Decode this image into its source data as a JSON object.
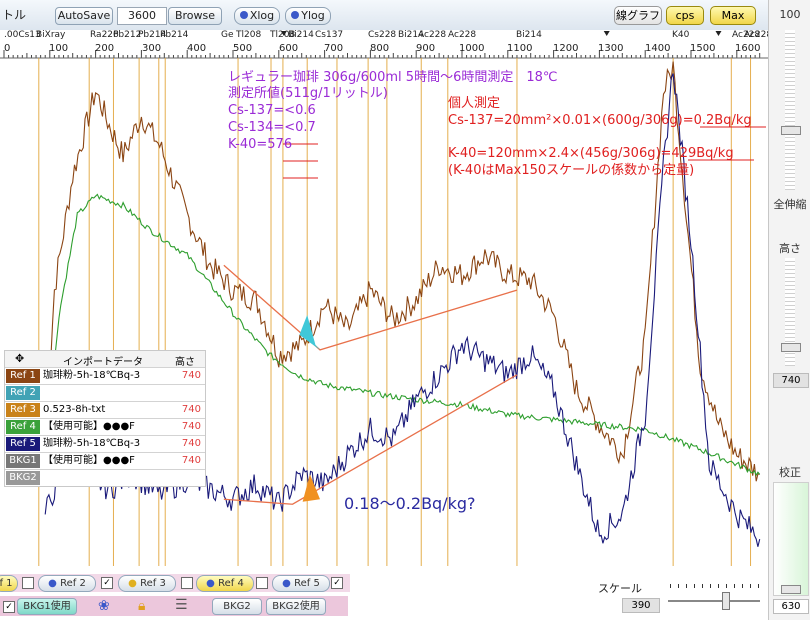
{
  "toolbar": {
    "title_fragment": "トル",
    "autosave": "AutoSave",
    "count_value": "3600",
    "browse": "Browse",
    "xlog": "Xlog",
    "ylog": "Ylog",
    "line_graph": "線グラフ",
    "cps": "cps",
    "max": "Max"
  },
  "ruler": {
    "energy_ticks": [
      "0",
      "100",
      "200",
      "300",
      "400",
      "500",
      "600",
      "700",
      "800",
      "900",
      "1000",
      "1100",
      "1200",
      "1300",
      "1400",
      "1500",
      "1600"
    ],
    "nuclide_labels": [
      ".00Cs13",
      "BiXray",
      "Ra226",
      "Pb212",
      "Pb214",
      "Pb214",
      "Ge",
      "Tl208",
      "Tl208",
      "Bi214",
      "Cs137",
      "Cs228",
      "Bi214",
      "Ac228",
      "Ac228",
      "Bi214",
      "K40",
      "Ac228",
      "Ac228"
    ]
  },
  "annotations": {
    "line1": "レギュラー珈琲 306g/600ml 5時間～6時間測定　18℃",
    "line2": "測定所値(511g/1リットル)",
    "line3": "Cs-137=<0.6",
    "line4": "Cs-134=<0.7",
    "line5": "K-40=576",
    "personal_title": "個人測定",
    "personal_cs": "Cs-137=20mm²×0.01×(600g/306g)=0.2Bq/kg",
    "personal_k": "K-40=120mm×2.4×(456g/306g)=429Bq/kg",
    "personal_note": "(K-40はMax150スケールの係数から定量)",
    "estimate": "0.18～0.2Bq/kg?"
  },
  "ref_panel": {
    "header_import": "インポートデータ",
    "header_height": "高さ",
    "rows": [
      {
        "tag": "Ref 1",
        "name": "珈琲粉-5h-18℃Bq-3",
        "value": "740",
        "color": "#8b4513"
      },
      {
        "tag": "Ref 2",
        "name": "",
        "value": "",
        "color": "#41a3b5"
      },
      {
        "tag": "Ref 3",
        "name": "0.523-8h-txt",
        "value": "740",
        "color": "#c9821a"
      },
      {
        "tag": "Ref 4",
        "name": "【使用可能】●●●F",
        "value": "740",
        "color": "#3aa13a"
      },
      {
        "tag": "Ref 5",
        "name": "珈琲粉-5h-18℃Bq-3",
        "value": "740",
        "color": "#1a1a7a"
      },
      {
        "tag": "BKG1",
        "name": "【使用可能】●●●F",
        "value": "740",
        "color": "#777777"
      },
      {
        "tag": "BKG2",
        "name": "",
        "value": "",
        "color": "#999999"
      }
    ]
  },
  "bottom": {
    "f1": "f 1",
    "ref2": "Ref 2",
    "ref3": "Ref 3",
    "ref4": "Ref 4",
    "ref5": "Ref 5",
    "bkg1_use": "BKG1使用",
    "bkg2": "BKG2",
    "bkg2_use": "BKG2使用",
    "scale_label": "スケール",
    "scale_value": "390"
  },
  "sidebar": {
    "top_value": "100",
    "full_width": "全伸縮",
    "height_label": "高さ",
    "height_value": "740",
    "calib_label": "校正",
    "bottom_value": "630"
  },
  "chart_data": {
    "type": "line",
    "xlabel": "",
    "ylabel": "",
    "xlim": [
      0,
      1650
    ],
    "peak_markers_keV": [
      76,
      186,
      239,
      295,
      338,
      352,
      511,
      583,
      609,
      662,
      727,
      795,
      836,
      911,
      969,
      1120,
      1461,
      1588,
      1630
    ],
    "series": [
      {
        "name": "Ref 1",
        "color": "#8b4513",
        "points": [
          [
            90,
            0.22
          ],
          [
            110,
            0.55
          ],
          [
            150,
            0.78
          ],
          [
            200,
            0.95
          ],
          [
            230,
            0.88
          ],
          [
            260,
            0.82
          ],
          [
            300,
            0.9
          ],
          [
            340,
            0.84
          ],
          [
            400,
            0.7
          ],
          [
            450,
            0.6
          ],
          [
            500,
            0.55
          ],
          [
            550,
            0.53
          ],
          [
            600,
            0.42
          ],
          [
            650,
            0.44
          ],
          [
            700,
            0.52
          ],
          [
            750,
            0.47
          ],
          [
            800,
            0.55
          ],
          [
            850,
            0.49
          ],
          [
            900,
            0.53
          ],
          [
            950,
            0.6
          ],
          [
            1000,
            0.58
          ],
          [
            1050,
            0.62
          ],
          [
            1100,
            0.58
          ],
          [
            1150,
            0.57
          ],
          [
            1200,
            0.5
          ],
          [
            1250,
            0.35
          ],
          [
            1300,
            0.28
          ],
          [
            1350,
            0.22
          ],
          [
            1400,
            0.45
          ],
          [
            1440,
            0.95
          ],
          [
            1461,
            1.0
          ],
          [
            1490,
            0.7
          ],
          [
            1520,
            0.4
          ],
          [
            1560,
            0.28
          ],
          [
            1600,
            0.22
          ],
          [
            1650,
            0.18
          ]
        ]
      },
      {
        "name": "Ref 4",
        "color": "#2e9e2e",
        "points": [
          [
            90,
            0.2
          ],
          [
            120,
            0.5
          ],
          [
            160,
            0.7
          ],
          [
            200,
            0.74
          ],
          [
            260,
            0.72
          ],
          [
            320,
            0.67
          ],
          [
            400,
            0.62
          ],
          [
            460,
            0.55
          ],
          [
            520,
            0.48
          ],
          [
            580,
            0.42
          ],
          [
            640,
            0.38
          ],
          [
            700,
            0.36
          ],
          [
            760,
            0.35
          ],
          [
            820,
            0.34
          ],
          [
            900,
            0.33
          ],
          [
            1000,
            0.32
          ],
          [
            1100,
            0.3
          ],
          [
            1200,
            0.29
          ],
          [
            1300,
            0.28
          ],
          [
            1400,
            0.27
          ],
          [
            1461,
            0.25
          ],
          [
            1520,
            0.23
          ],
          [
            1600,
            0.2
          ],
          [
            1650,
            0.18
          ]
        ]
      },
      {
        "name": "Ref 5",
        "color": "#1a1a7a",
        "points": [
          [
            90,
            0.1
          ],
          [
            130,
            0.2
          ],
          [
            180,
            0.18
          ],
          [
            230,
            0.15
          ],
          [
            280,
            0.18
          ],
          [
            340,
            0.14
          ],
          [
            400,
            0.17
          ],
          [
            450,
            0.15
          ],
          [
            500,
            0.13
          ],
          [
            550,
            0.16
          ],
          [
            600,
            0.12
          ],
          [
            650,
            0.18
          ],
          [
            700,
            0.16
          ],
          [
            750,
            0.22
          ],
          [
            800,
            0.27
          ],
          [
            850,
            0.25
          ],
          [
            900,
            0.33
          ],
          [
            950,
            0.38
          ],
          [
            1000,
            0.44
          ],
          [
            1050,
            0.41
          ],
          [
            1100,
            0.38
          ],
          [
            1150,
            0.42
          ],
          [
            1200,
            0.35
          ],
          [
            1250,
            0.2
          ],
          [
            1300,
            0.06
          ],
          [
            1350,
            0.1
          ],
          [
            1400,
            0.3
          ],
          [
            1440,
            0.8
          ],
          [
            1461,
            1.0
          ],
          [
            1500,
            0.65
          ],
          [
            1540,
            0.2
          ],
          [
            1600,
            0.1
          ],
          [
            1650,
            0.05
          ]
        ]
      }
    ]
  }
}
